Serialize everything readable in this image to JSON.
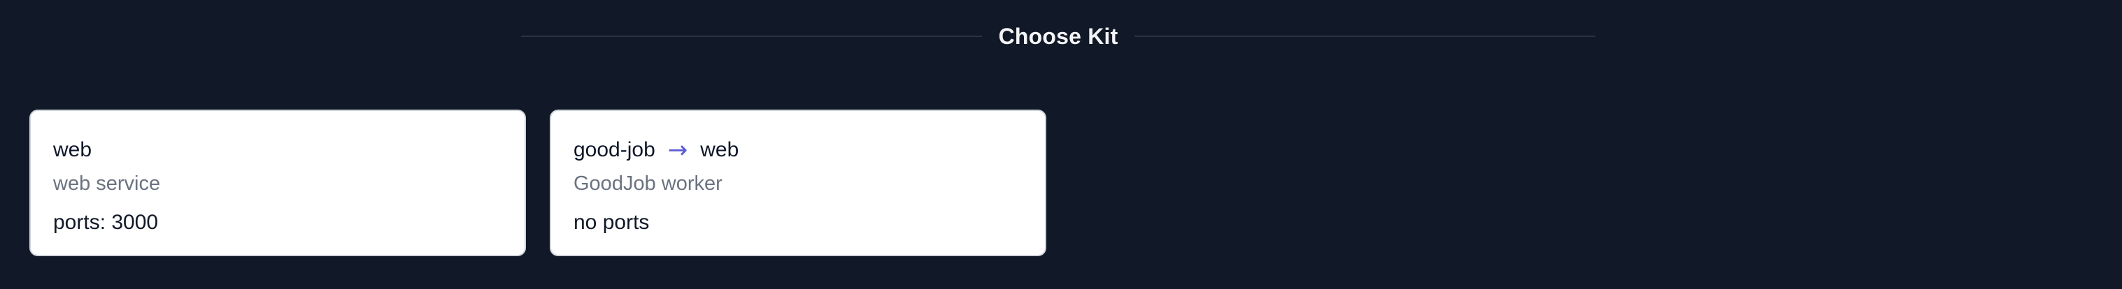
{
  "section": {
    "title": "Choose Kit"
  },
  "kits": [
    {
      "name": "web",
      "description": "web service",
      "ports": "ports: 3000"
    },
    {
      "name": "good-job",
      "arrow": "→",
      "target": "web",
      "description": "GoodJob worker",
      "ports": "no ports"
    }
  ],
  "colors": {
    "background": "#111827",
    "card_background": "#ffffff",
    "arrow": "#5b5bd6",
    "muted_text": "#6b7280"
  }
}
